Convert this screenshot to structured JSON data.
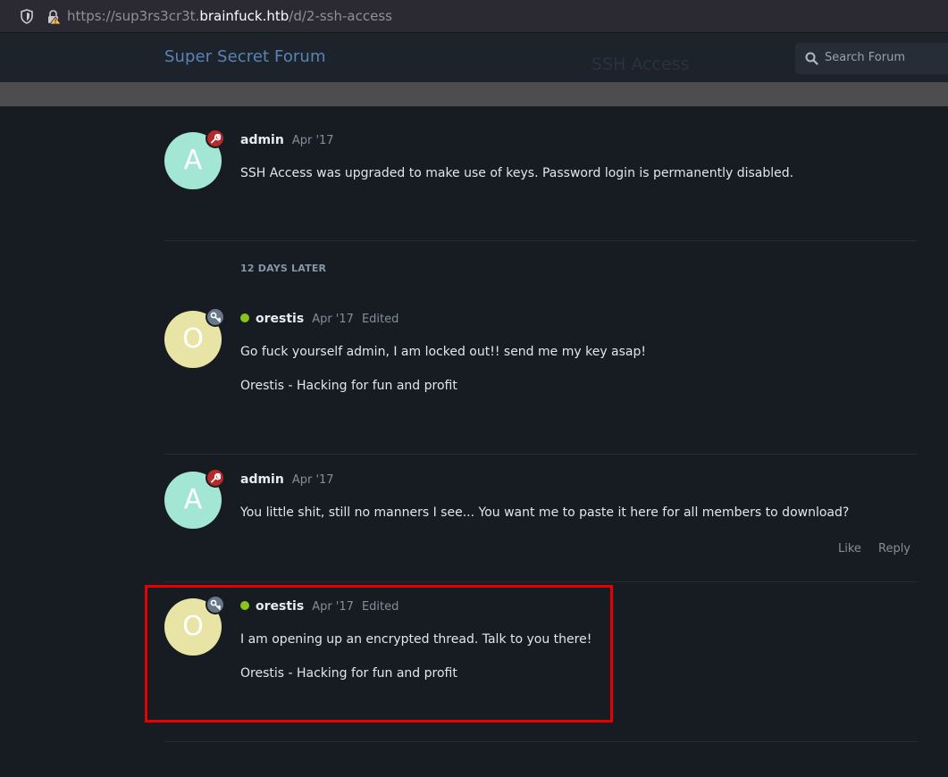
{
  "browser": {
    "url_scheme": "https://",
    "url_sub": "sup3rs3cr3t.",
    "url_host": "brainfuck.htb",
    "url_path": "/d/2-ssh-access"
  },
  "header": {
    "brand": "Super Secret Forum",
    "discussion_title": "SSH Access",
    "search_placeholder": "Search Forum"
  },
  "separator": "12 DAYS LATER",
  "posts": [
    {
      "avatar_letter": "A",
      "username": "admin",
      "date": "Apr '17",
      "lines": [
        "SSH Access was upgraded to make use of keys. Password login is permanently disabled."
      ]
    },
    {
      "avatar_letter": "O",
      "username": "orestis",
      "date": "Apr '17",
      "edited": "Edited",
      "lines": [
        "Go fuck yourself admin, I am locked out!! send me my key asap!",
        "Orestis - Hacking for fun and profit"
      ]
    },
    {
      "avatar_letter": "A",
      "username": "admin",
      "date": "Apr '17",
      "lines": [
        "You little shit, still no manners I see... You want me to paste it here for all members to download?"
      ],
      "like": "Like",
      "reply": "Reply"
    },
    {
      "avatar_letter": "O",
      "username": "orestis",
      "date": "Apr '17",
      "edited": "Edited",
      "lines": [
        "I am opening up an encrypted thread. Talk to you there!",
        "Orestis - Hacking for fun and profit"
      ]
    }
  ],
  "colors": {
    "admin_badge": "#b72a2a",
    "member_badge": "#677788",
    "online": "#88c61c",
    "highlight": "#e60000"
  }
}
